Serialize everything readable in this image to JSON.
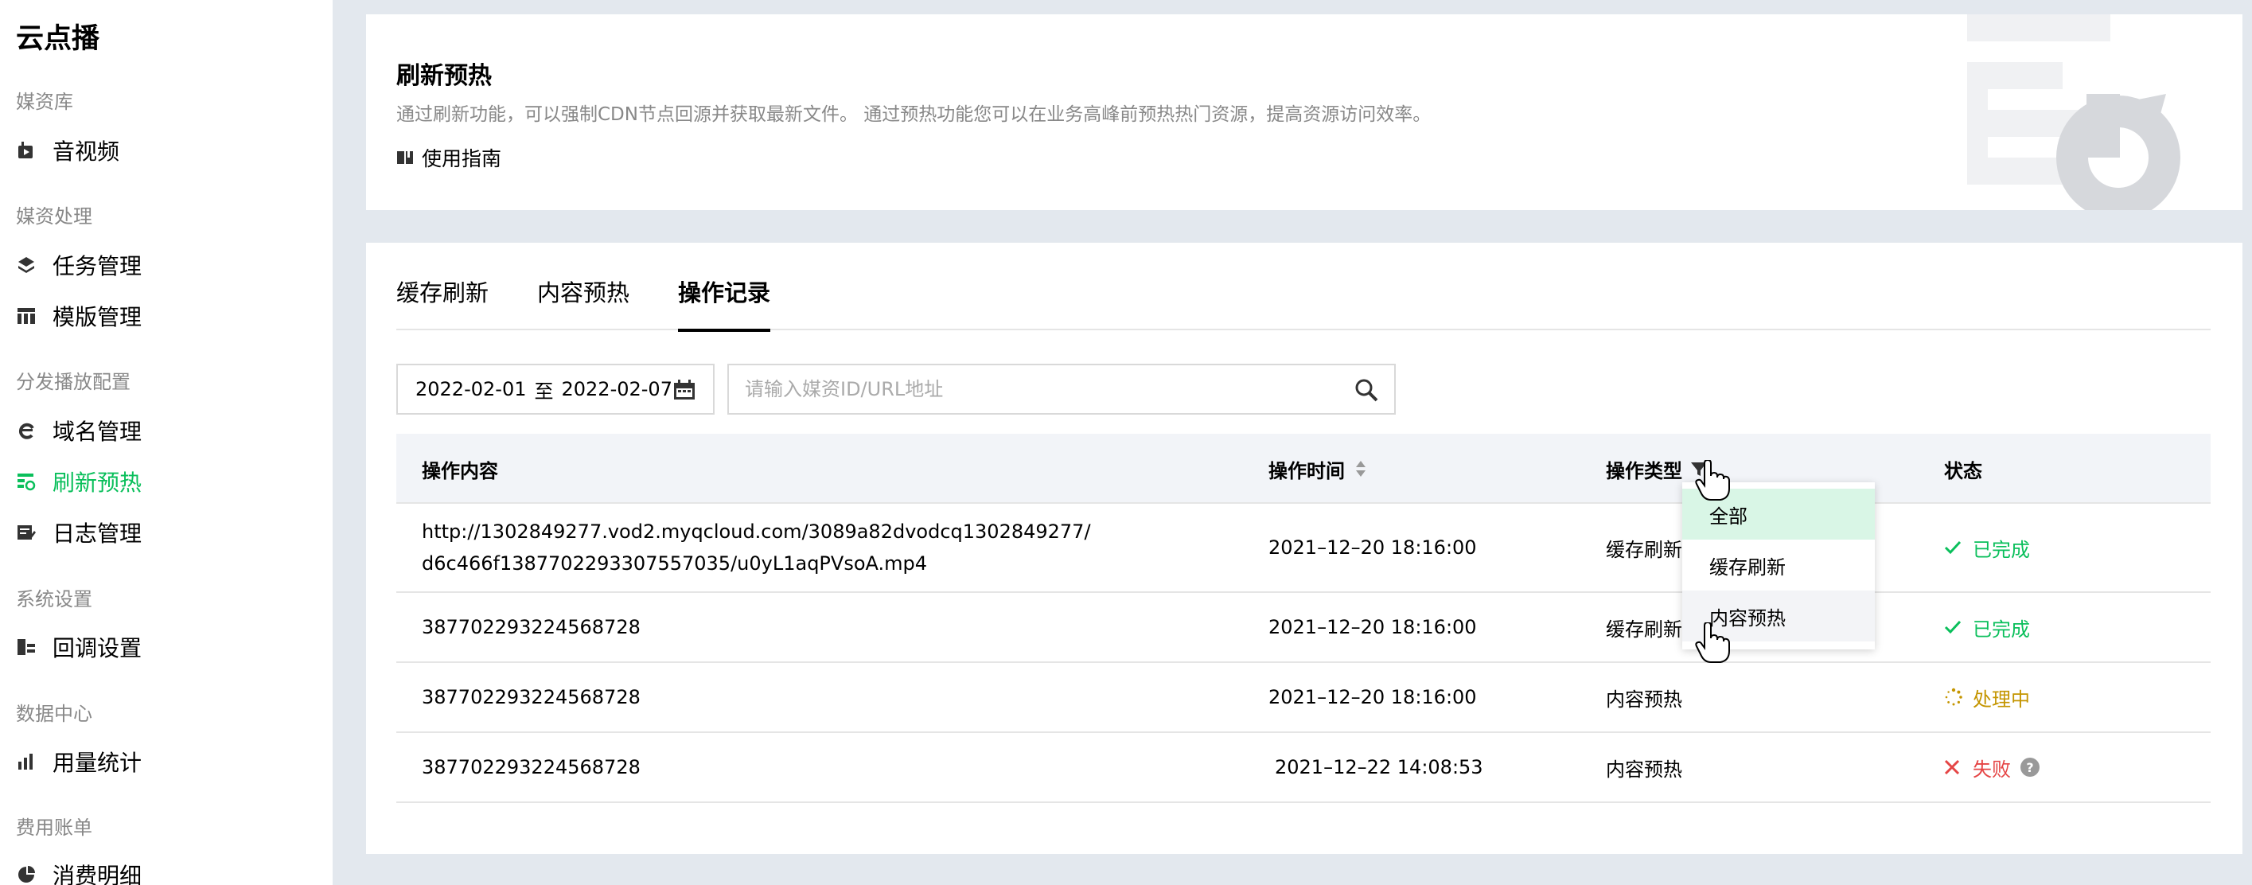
{
  "app": {
    "title": "云点播"
  },
  "sidebar": {
    "groups": [
      {
        "title": "媒资库",
        "items": [
          {
            "label": "音视频",
            "icon": "media-icon"
          }
        ]
      },
      {
        "title": "媒资处理",
        "items": [
          {
            "label": "任务管理",
            "icon": "layers-icon"
          },
          {
            "label": "模版管理",
            "icon": "template-icon"
          }
        ]
      },
      {
        "title": "分发播放配置",
        "items": [
          {
            "label": "域名管理",
            "icon": "domain-icon"
          },
          {
            "label": "刷新预热",
            "icon": "refresh-icon",
            "active": true
          },
          {
            "label": "日志管理",
            "icon": "log-icon"
          }
        ]
      },
      {
        "title": "系统设置",
        "items": [
          {
            "label": "回调设置",
            "icon": "callback-icon"
          }
        ]
      },
      {
        "title": "数据中心",
        "items": [
          {
            "label": "用量统计",
            "icon": "stats-icon"
          }
        ]
      },
      {
        "title": "费用账单",
        "items": [
          {
            "label": "消费明细",
            "icon": "pie-icon"
          }
        ]
      }
    ]
  },
  "header": {
    "title": "刷新预热",
    "description": "通过刷新功能，可以强制CDN节点回源并获取最新文件。 通过预热功能您可以在业务高峰前预热热门资源，提高资源访问效率。",
    "guide_label": "使用指南"
  },
  "tabs": [
    {
      "label": "缓存刷新",
      "active": false
    },
    {
      "label": "内容预热",
      "active": false
    },
    {
      "label": "操作记录",
      "active": true
    }
  ],
  "filters": {
    "date_start": "2022-02-01",
    "date_sep": "至",
    "date_end": "2022-02-07",
    "search_placeholder": "请输入媒资ID/URL地址"
  },
  "table": {
    "columns": [
      "操作内容",
      "操作时间",
      "操作类型",
      "状态"
    ],
    "rows": [
      {
        "content_line1": "http://1302849277.vod2.myqcloud.com/3089a82dvodcq1302849277/",
        "content_line2": "d6c466f1387702293307557035/u0yL1aqPVsoA.mp4",
        "time": "2021–12–20 18:16:00",
        "type": "缓存刷新",
        "status": "已完成",
        "status_kind": "done"
      },
      {
        "content_line1": "387702293224568728",
        "time": "2021–12–20 18:16:00",
        "type": "缓存刷新",
        "status": "已完成",
        "status_kind": "done"
      },
      {
        "content_line1": "387702293224568728",
        "time": "2021–12–20 18:16:00",
        "type": "内容预热",
        "status": "处理中",
        "status_kind": "processing"
      },
      {
        "content_line1": "387702293224568728",
        "time": "2021–12–22 14:08:53",
        "type": "内容预热",
        "status": "失败",
        "status_kind": "failed"
      }
    ]
  },
  "type_filter": {
    "options": [
      {
        "label": "全部",
        "selected": true
      },
      {
        "label": "缓存刷新"
      },
      {
        "label": "内容预热",
        "hover": true
      }
    ]
  },
  "colors": {
    "accent": "#0abf5b",
    "processing": "#c49500",
    "failed": "#e54545",
    "background": "#e3e8ee"
  }
}
